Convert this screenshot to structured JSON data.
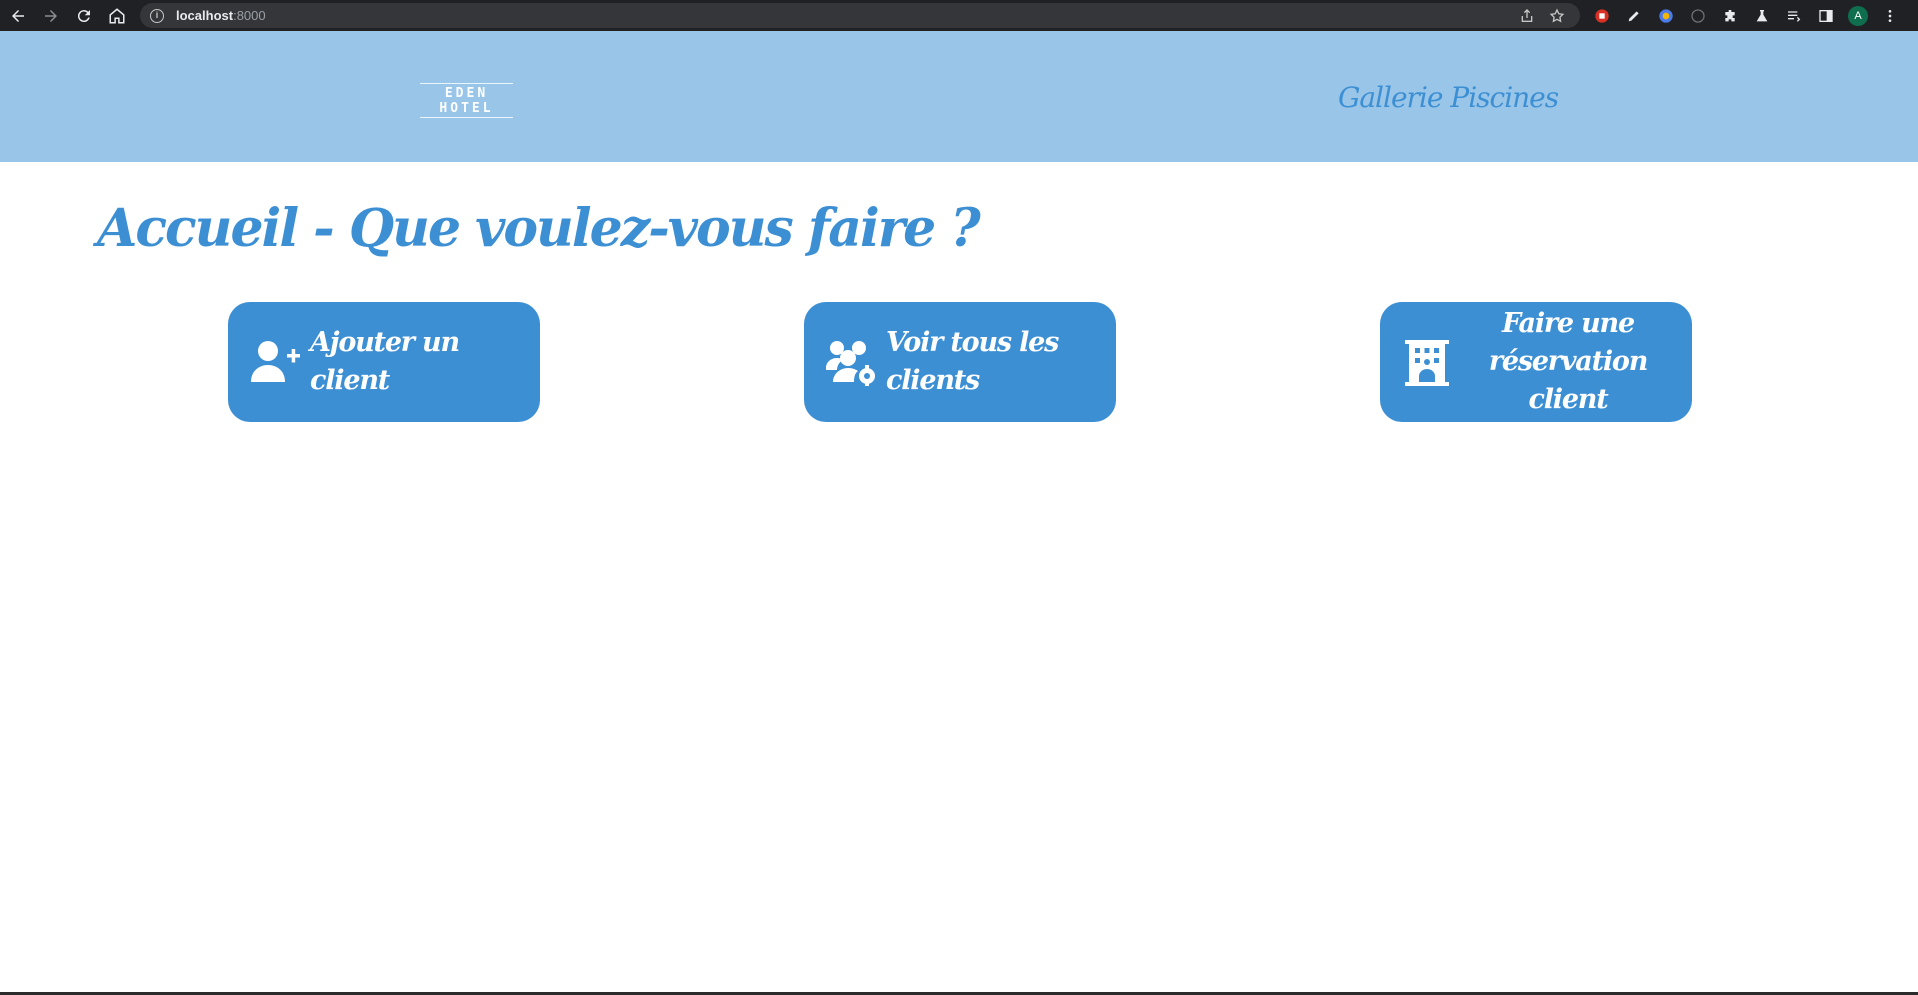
{
  "browser": {
    "url_host": "localhost",
    "url_port": ":8000",
    "avatar_initial": "A"
  },
  "header": {
    "logo_text": "EDEN HOTEL",
    "nav_link": "Gallerie Piscines"
  },
  "main": {
    "title": "Accueil - Que voulez-vous faire ?",
    "actions": [
      {
        "label": "Ajouter un client",
        "icon": "user-plus-icon"
      },
      {
        "label": "Voir tous les clients",
        "icon": "users-cog-icon"
      },
      {
        "label": "Faire une réservation client",
        "label_line1": "Faire une",
        "label_line2": "réservation client",
        "icon": "hotel-icon"
      }
    ]
  },
  "colors": {
    "header_bg": "#98c5e8",
    "accent": "#3d8fd4",
    "button_text": "#ffffff"
  }
}
